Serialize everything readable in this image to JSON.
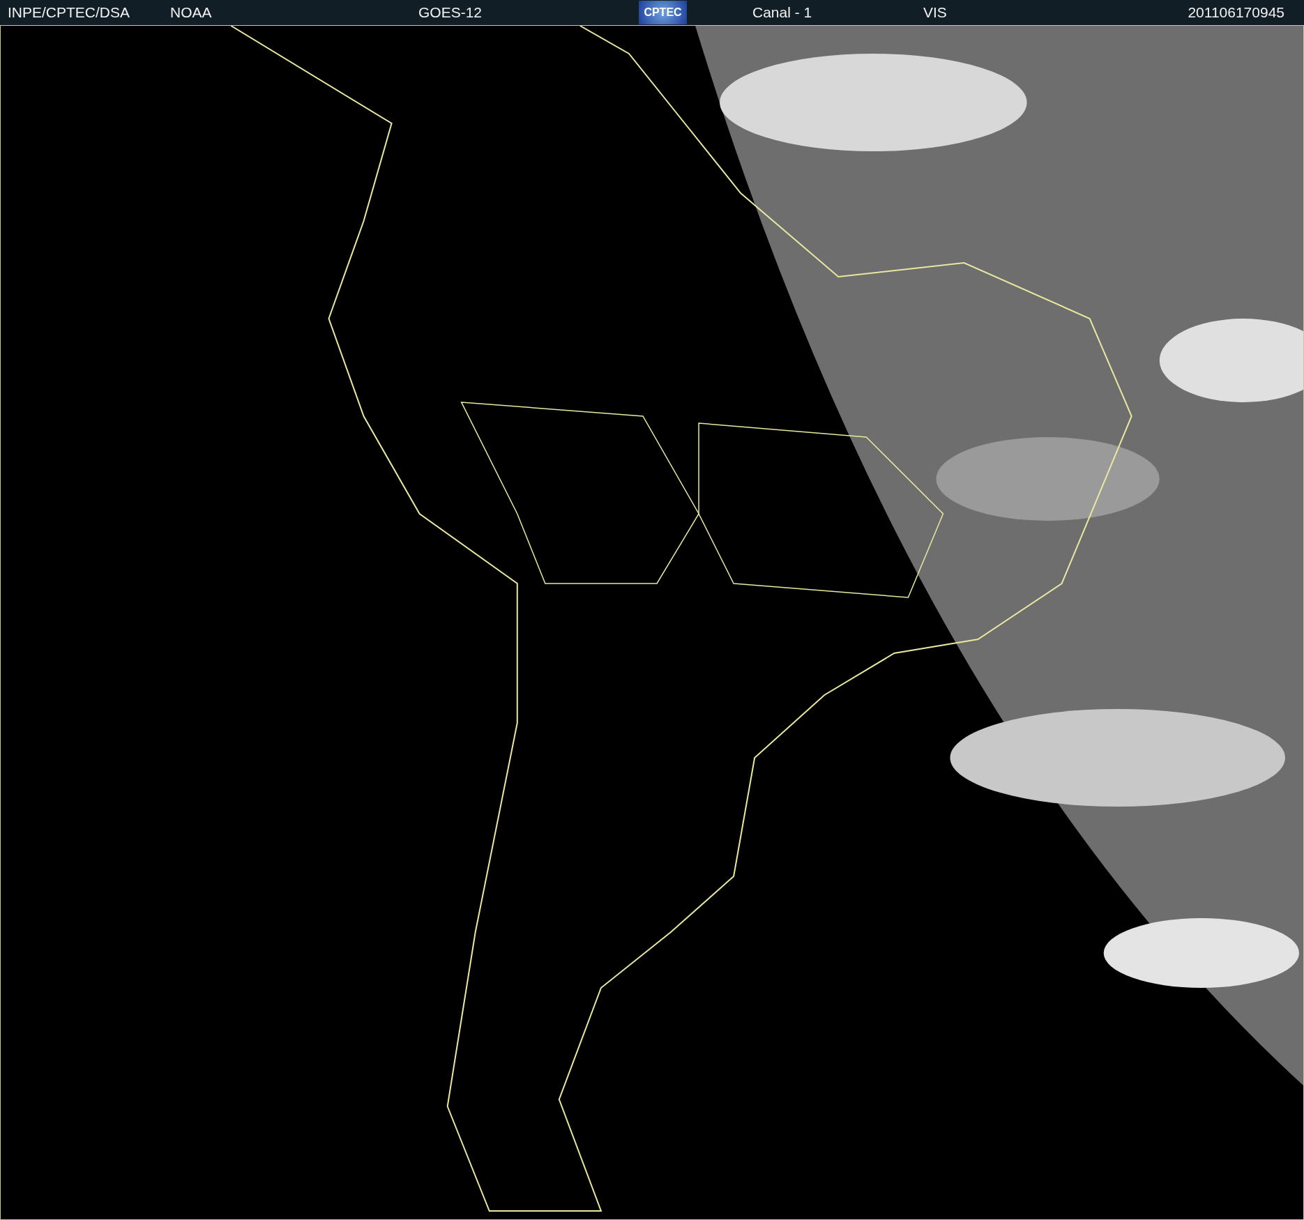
{
  "header": {
    "source": "INPE/CPTEC/DSA",
    "agency": "NOAA",
    "satellite": "GOES-12",
    "logo": "CPTEC",
    "channel": "Canal - 1",
    "band": "VIS",
    "timestamp": "201106170945"
  }
}
